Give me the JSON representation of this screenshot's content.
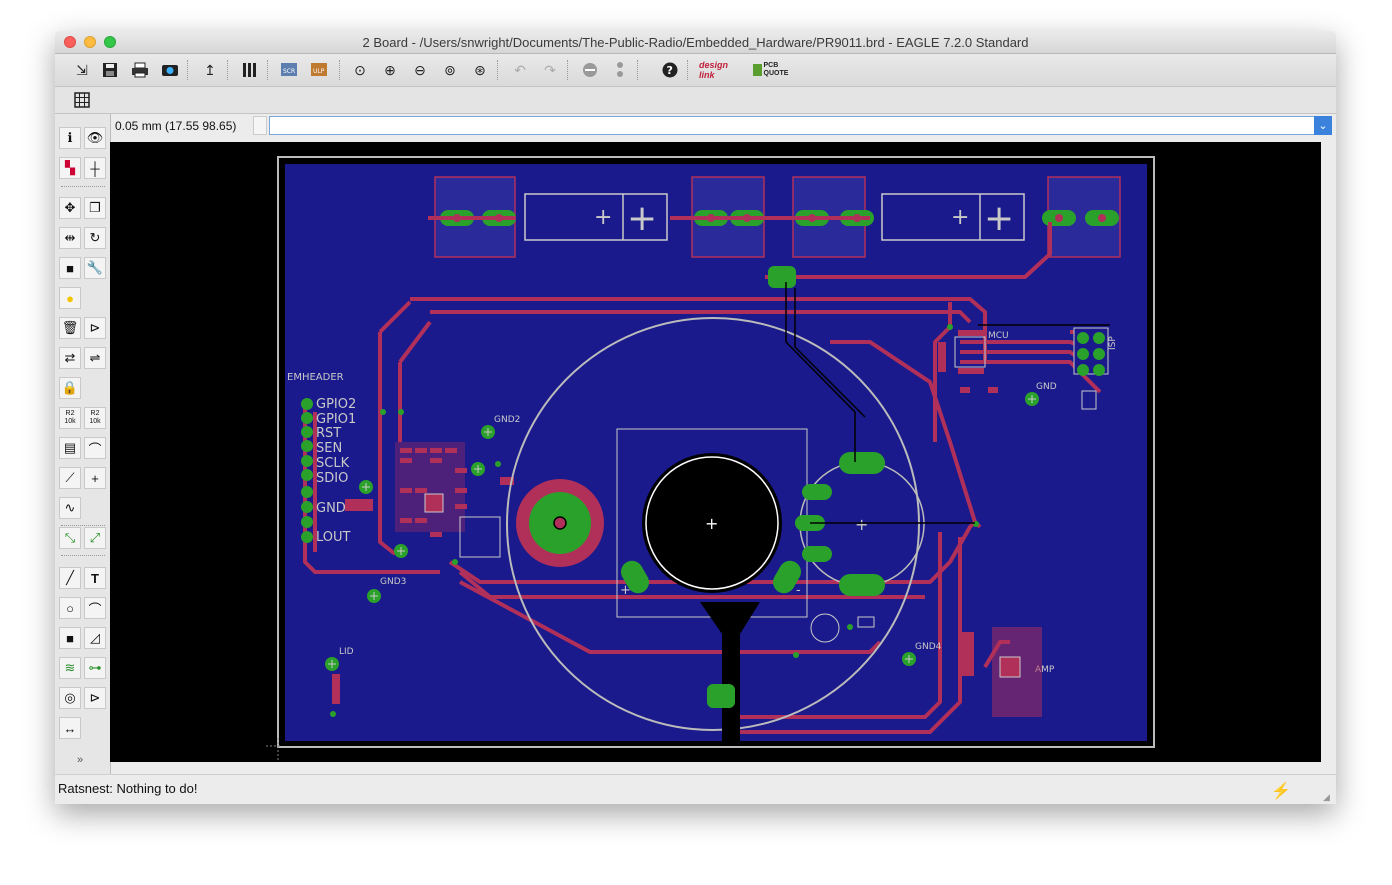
{
  "window": {
    "title": "2 Board - /Users/snwright/Documents/The-Public-Radio/Embedded_Hardware/PR9011.brd - EAGLE 7.2.0 Standard"
  },
  "toolbar": {
    "buttons": [
      "open-icon",
      "save-icon",
      "print-icon",
      "cam-icon",
      "script-icon",
      "library-icon",
      "scr-icon",
      "ulp-icon",
      "zoom-fit-icon",
      "zoom-in-icon",
      "zoom-out-icon",
      "zoom-redraw-icon",
      "zoom-select-icon",
      "undo-icon",
      "redo-icon",
      "stop-icon",
      "go-icon",
      "help-icon",
      "design-link-icon",
      "pcb-quote-icon"
    ],
    "design_link_label": "design link",
    "pcb_quote_label": "PCB QUOTE"
  },
  "coords": {
    "readout": "0.05 mm (17.55 98.65)"
  },
  "command": {
    "value": "",
    "placeholder": ""
  },
  "sidebar": {
    "groups": [
      [
        "info-icon",
        "show-icon"
      ],
      [
        "display-icon",
        "mark-icon"
      ],
      [
        "move-icon",
        "copy-icon"
      ],
      [
        "mirror-icon",
        "rotate-icon"
      ],
      [
        "group-icon",
        "change-icon"
      ],
      [
        "paste-icon"
      ],
      [
        "delete-icon",
        "add-icon"
      ],
      [
        "replace-icon",
        "lock-icon"
      ],
      [
        "lock-icon-2"
      ],
      [
        "name-icon",
        "value-icon"
      ],
      [
        "smash-icon",
        "miter-icon"
      ],
      [
        "split-icon",
        "optimize-icon"
      ],
      [
        "meander-icon"
      ],
      [
        "route-icon",
        "ripup-icon"
      ],
      [
        "wire-icon",
        "text-icon"
      ],
      [
        "circle-icon",
        "arc-icon"
      ],
      [
        "rect-icon",
        "polygon-icon"
      ],
      [
        "via-icon",
        "signal-icon"
      ],
      [
        "hole-icon",
        "attribute-icon"
      ],
      [
        "dimension-icon"
      ]
    ],
    "value_label_1": "R2 10k",
    "value_label_2": "R2 10k",
    "more": "»"
  },
  "pcb": {
    "labels": [
      "EMHEADER",
      "GPIO2",
      "GPIO1",
      "RST",
      "SEN",
      "SCLK",
      "SDIO",
      "GND",
      "LOUT",
      "GND2",
      "GND3",
      "GND4",
      "GND",
      "MCU",
      "ISP",
      "AMP",
      "LID"
    ],
    "colors": {
      "board_bg": "#1a1a8c",
      "trace": "#b0305a",
      "pad": "#2aa12a",
      "outline": "#bbbbbb"
    }
  },
  "status": {
    "message": "Ratsnest: Nothing to do!"
  }
}
